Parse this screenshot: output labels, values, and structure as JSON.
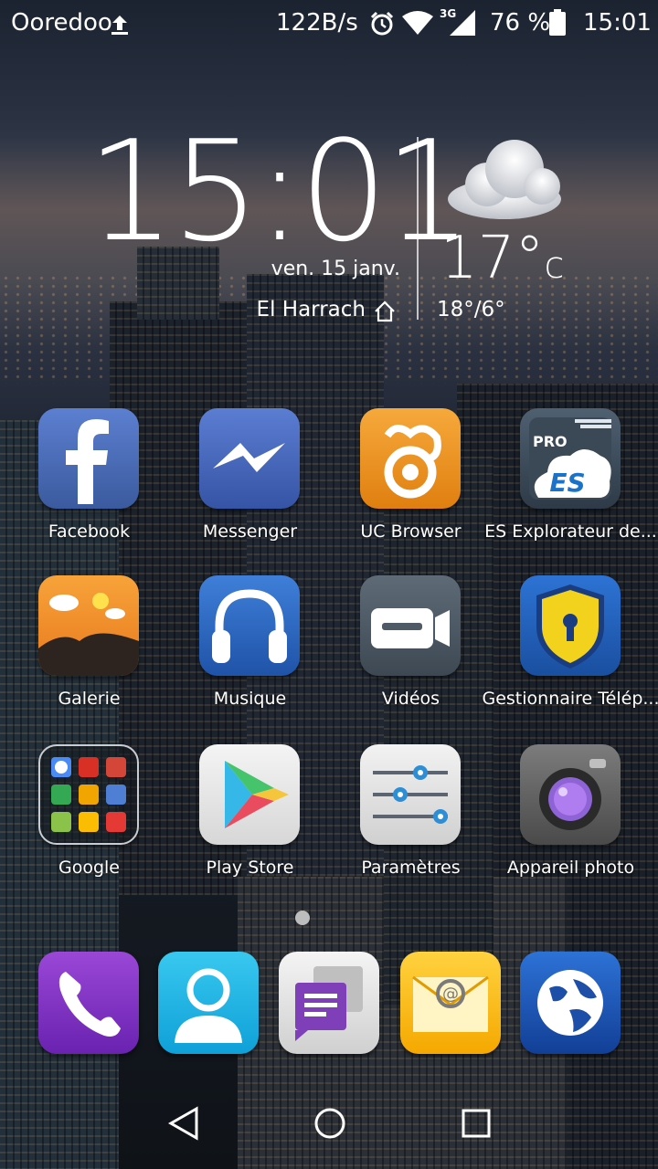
{
  "status_bar": {
    "carrier": "Ooredoo",
    "net_speed": "122B/s",
    "network_type": "3G",
    "battery": "76 %",
    "time": "15:01",
    "icons": [
      "upload-icon",
      "alarm-icon",
      "wifi-icon",
      "signal-icon",
      "battery-icon"
    ]
  },
  "clock_widget": {
    "time": "15:01",
    "date": "ven. 15 janv.",
    "location": "El Harrach",
    "temperature": "17°",
    "unit": "c",
    "range": "18°/6°",
    "weather": "cloudy-icon"
  },
  "apps": [
    {
      "label": "Facebook",
      "icon": "facebook-icon"
    },
    {
      "label": "Messenger",
      "icon": "messenger-icon"
    },
    {
      "label": "UC Browser",
      "icon": "uc-browser-icon"
    },
    {
      "label": "ES Explorateur de...",
      "icon": "es-explorer-icon"
    },
    {
      "label": "Galerie",
      "icon": "gallery-icon"
    },
    {
      "label": "Musique",
      "icon": "music-icon"
    },
    {
      "label": "Vidéos",
      "icon": "videos-icon"
    },
    {
      "label": "Gestionnaire Télép...",
      "icon": "phone-manager-icon"
    },
    {
      "label": "Google",
      "icon": "google-folder-icon"
    },
    {
      "label": "Play Store",
      "icon": "play-store-icon"
    },
    {
      "label": "Paramètres",
      "icon": "settings-icon"
    },
    {
      "label": "Appareil photo",
      "icon": "camera-icon"
    }
  ],
  "dock": [
    "phone-icon",
    "contacts-icon",
    "messages-icon",
    "email-icon",
    "browser-icon"
  ],
  "es_badge": "PRO",
  "es_logo": "ES",
  "nav": [
    "back-icon",
    "home-icon",
    "recents-icon"
  ]
}
